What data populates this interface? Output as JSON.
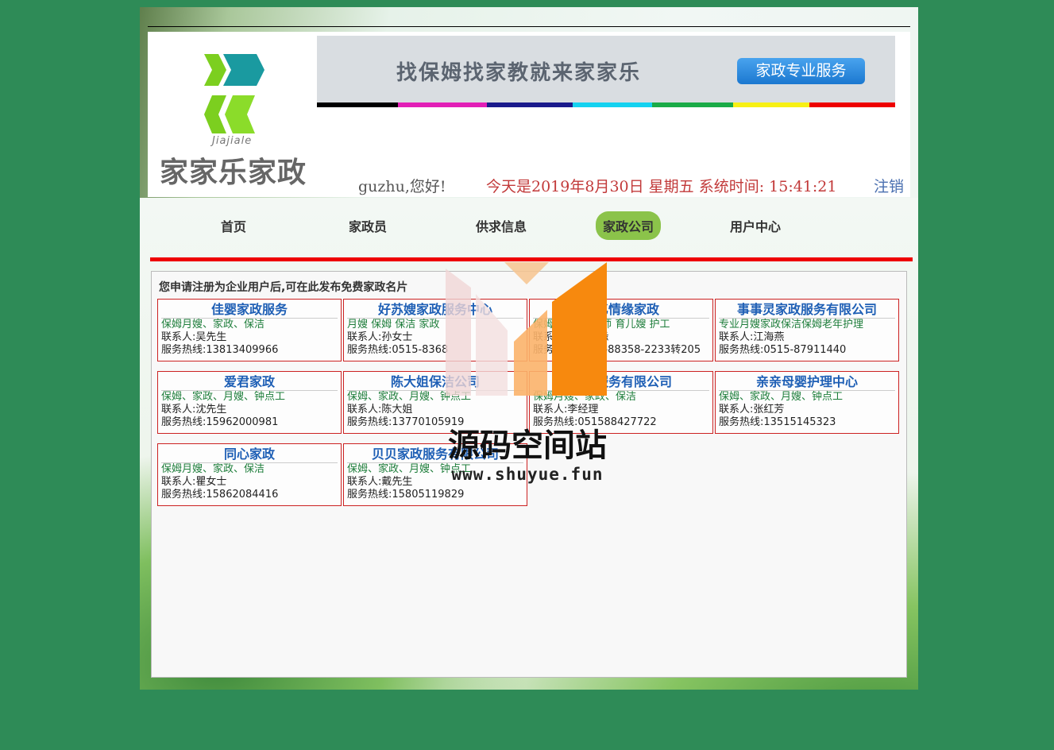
{
  "header": {
    "logo_sub": "Jiajiale",
    "logo_text": "家家乐家政",
    "banner_slogan": "找保姆找家教就来家家乐",
    "banner_button": "家政专业服务"
  },
  "colors": {
    "page_bg": "#2e8b57",
    "nav_red": "#ee0000",
    "strip": [
      "#000000",
      "#e21fb6",
      "#1a1a8c",
      "#14d2f0",
      "#1aab47",
      "#f7f014",
      "#ee0000"
    ]
  },
  "user_bar": {
    "greeting": "guzhu,您好!",
    "date": "今天是2019年8月30日  星期五  系统时间: 15:41:21",
    "logout": "注销"
  },
  "nav": {
    "items": [
      "首页",
      "家政员",
      "供求信息",
      "家政公司",
      "用户中心"
    ],
    "active": "家政公司"
  },
  "content": {
    "notice": "您申请注册为企业用户后,可在此发布免费家政名片",
    "companies": [
      {
        "name": "佳婴家政服务",
        "services": "保姆月嫂、家政、保洁",
        "contact": "联系人:吴先生",
        "phone": "服务热线:13813409966"
      },
      {
        "name": "好苏嫂家政服务中心",
        "services": "月嫂 保姆 保洁 家政",
        "contact": "联系人:孙女士",
        "phone": "服务热线:0515-8368"
      },
      {
        "name": "创亿情缘家政",
        "services": "保姆 月嫂 早教师 育儿嫂 护工",
        "contact": "联系人:创亿情缘",
        "phone": "服务热线:0515-88358-2233转205"
      },
      {
        "name": "事事灵家政服务有限公司",
        "services": "专业月嫂家政保洁保姆老年护理",
        "contact": "联系人:江海燕",
        "phone": "服务热线:0515-87911440"
      },
      {
        "name": "爱君家政",
        "services": "保姆、家政、月嫂、钟点工",
        "contact": "联系人:沈先生",
        "phone": "服务热线:15962000981"
      },
      {
        "name": "陈大姐保洁公司",
        "services": "保姆、家政、月嫂、钟点工",
        "contact": "联系人:陈大姐",
        "phone": "服务热线:13770105919"
      },
      {
        "name": "家政服务有限公司",
        "services": "保姆月嫂、家政、保洁",
        "contact": "联系人:李经理",
        "phone": "服务热线:051588427722"
      },
      {
        "name": "亲亲母婴护理中心",
        "services": "保姆、家政、月嫂、钟点工",
        "contact": "联系人:张红芳",
        "phone": "服务热线:13515145323"
      },
      {
        "name": "同心家政",
        "services": "保姆月嫂、家政、保洁",
        "contact": "联系人:瞿女士",
        "phone": "服务热线:15862084416"
      },
      {
        "name": "贝贝家政服务有限公司",
        "services": "保姆、家政、月嫂、钟点工",
        "contact": "联系人:戴先生",
        "phone": "服务热线:15805119829"
      }
    ]
  },
  "watermark": {
    "text": "源码空间站",
    "url": "www.shuyue.fun"
  }
}
